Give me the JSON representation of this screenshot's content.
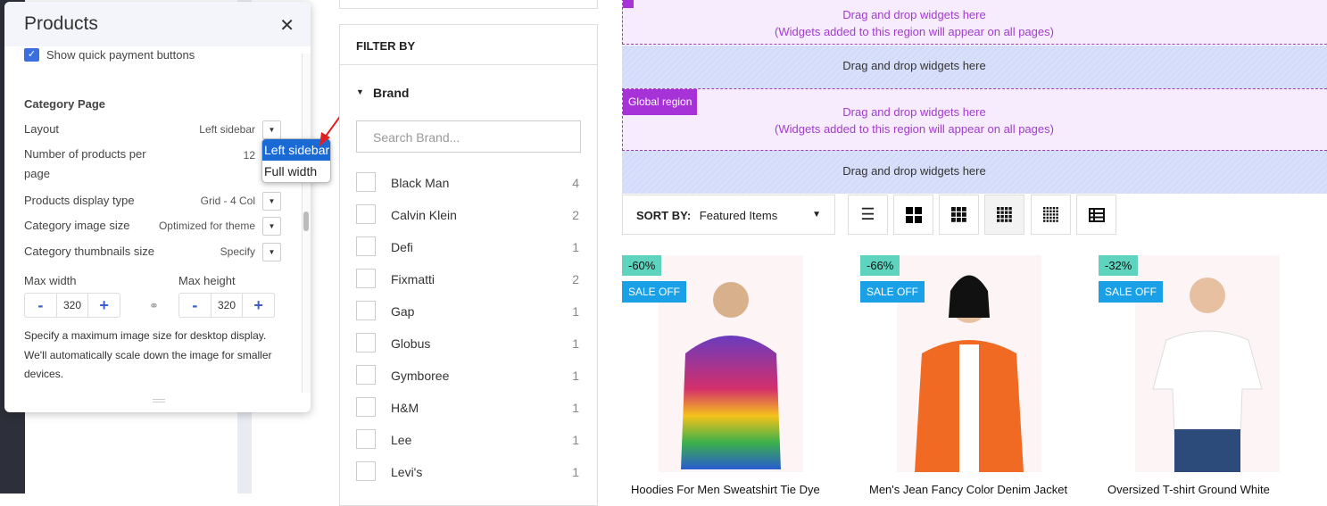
{
  "panel": {
    "title": "Products",
    "quick_payment": "Show quick payment buttons",
    "section": "Category Page",
    "rows": [
      {
        "label": "Layout",
        "value": "Left sidebar"
      },
      {
        "label": "Number of products per page",
        "value": "12"
      },
      {
        "label": "Products display type",
        "value": "Grid - 4 Col"
      },
      {
        "label": "Category image size",
        "value": "Optimized for theme"
      },
      {
        "label": "Category thumbnails size",
        "value": "Specify"
      }
    ],
    "max_width_label": "Max width",
    "max_height_label": "Max height",
    "max_width": "320",
    "max_height": "320",
    "minus": "-",
    "plus": "+",
    "help": "Specify a maximum image size for desktop display. We'll automatically scale down the image for smaller devices."
  },
  "layout_dropdown": {
    "options": [
      "Left sidebar",
      "Full width"
    ],
    "selected": "Left sidebar"
  },
  "filter": {
    "title": "FILTER BY",
    "brand_heading": "Brand",
    "search_placeholder": "Search Brand...",
    "brands": [
      {
        "name": "Black Man",
        "count": "4"
      },
      {
        "name": "Calvin Klein",
        "count": "2"
      },
      {
        "name": "Defi",
        "count": "1"
      },
      {
        "name": "Fixmatti",
        "count": "2"
      },
      {
        "name": "Gap",
        "count": "1"
      },
      {
        "name": "Globus",
        "count": "1"
      },
      {
        "name": "Gymboree",
        "count": "1"
      },
      {
        "name": "H&M",
        "count": "1"
      },
      {
        "name": "Lee",
        "count": "1"
      },
      {
        "name": "Levi's",
        "count": "1"
      }
    ]
  },
  "regions": {
    "global_label": "Global region",
    "dnd": "Drag and drop widgets here",
    "global_note": "(Widgets added to this region will appear on all pages)"
  },
  "sort": {
    "label": "SORT BY:",
    "value": "Featured Items"
  },
  "view_icons": [
    "list-view-icon",
    "grid-2-icon",
    "grid-3-icon",
    "grid-4-icon",
    "grid-5-icon",
    "table-view-icon"
  ],
  "products": [
    {
      "discount": "-60%",
      "badge": "SALE OFF",
      "name": "Hoodies For Men Sweatshirt Tie Dye"
    },
    {
      "discount": "-66%",
      "badge": "SALE OFF",
      "name": "Men's Jean Fancy Color Denim Jacket"
    },
    {
      "discount": "-32%",
      "badge": "SALE OFF",
      "name": "Oversized T-shirt Ground White"
    }
  ],
  "colors": {
    "accent": "#3b6fe0",
    "global_region": "#a632d8",
    "discount": "#5ed4be",
    "sale": "#1aa0e6"
  }
}
